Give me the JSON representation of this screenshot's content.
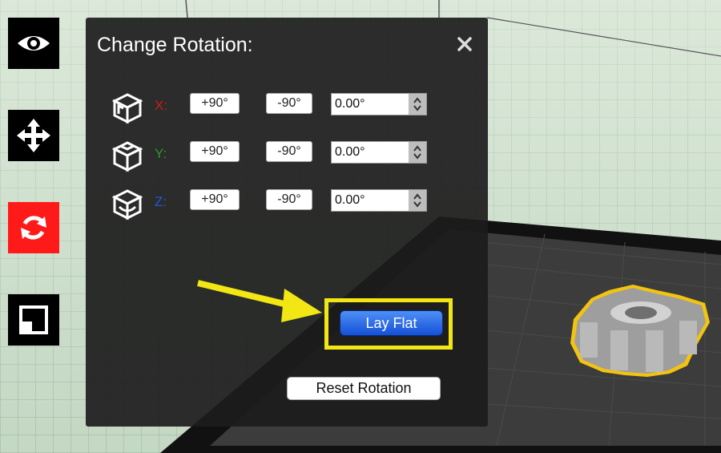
{
  "toolbar": {
    "items": [
      {
        "name": "view",
        "icon": "eye-icon",
        "active": false
      },
      {
        "name": "move",
        "icon": "move-icon",
        "active": false
      },
      {
        "name": "rotate",
        "icon": "rotate-icon",
        "active": true
      },
      {
        "name": "scale",
        "icon": "scale-icon",
        "active": false
      }
    ],
    "active_color": "#ff1a1a"
  },
  "panel": {
    "title": "Change Rotation:",
    "close_label": "✕",
    "axes": [
      {
        "label": "X:",
        "color": "#c81e1e",
        "plus_label": "+90°",
        "minus_label": "-90°",
        "value": "0.00°"
      },
      {
        "label": "Y:",
        "color": "#2a9a2a",
        "plus_label": "+90°",
        "minus_label": "-90°",
        "value": "0.00°"
      },
      {
        "label": "Z:",
        "color": "#2456d8",
        "plus_label": "+90°",
        "minus_label": "-90°",
        "value": "0.00°"
      }
    ],
    "lay_flat_label": "Lay Flat",
    "reset_label": "Reset Rotation"
  },
  "annotation": {
    "highlight_color": "#f2e614"
  },
  "model": {
    "name": "gear",
    "selection_color": "#f2c40f"
  }
}
